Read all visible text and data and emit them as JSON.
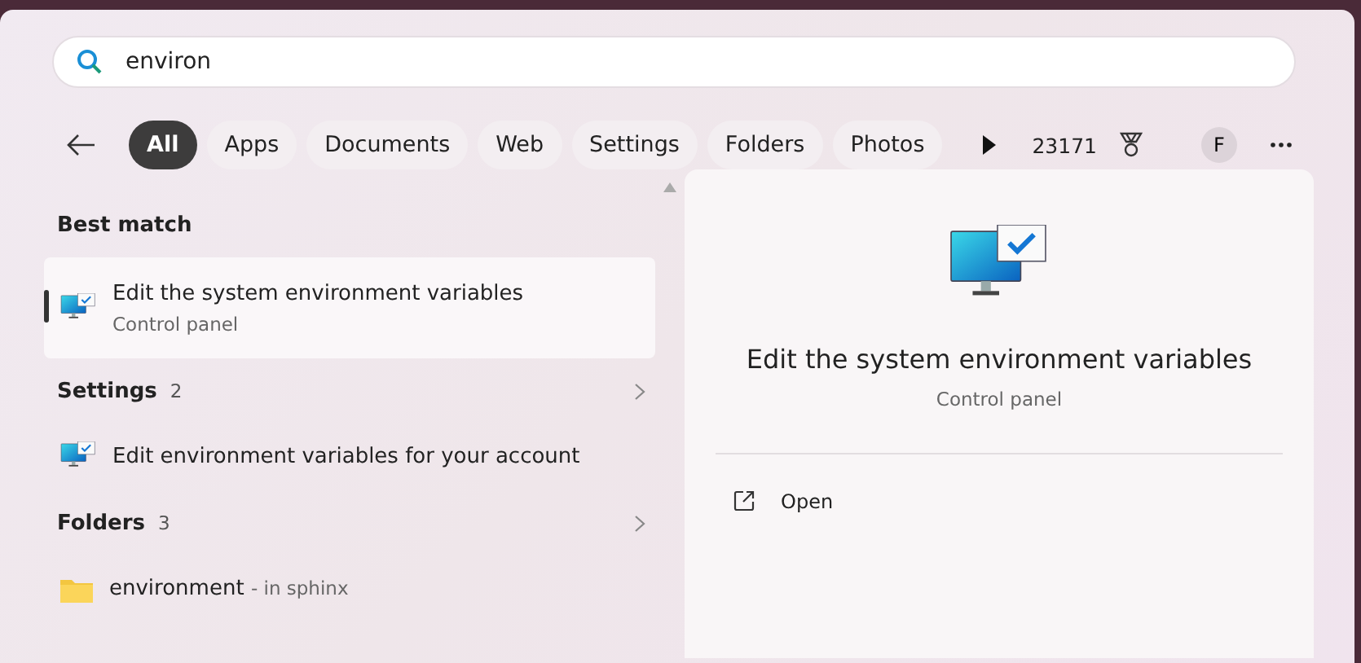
{
  "search": {
    "value": "environ"
  },
  "filters": [
    {
      "label": "All",
      "selected": true
    },
    {
      "label": "Apps",
      "selected": false
    },
    {
      "label": "Documents",
      "selected": false
    },
    {
      "label": "Web",
      "selected": false
    },
    {
      "label": "Settings",
      "selected": false
    },
    {
      "label": "Folders",
      "selected": false
    },
    {
      "label": "Photos",
      "selected": false
    }
  ],
  "points": "23171",
  "avatar": "F",
  "results": [
    {
      "kind": "header",
      "title": "Best match"
    },
    {
      "kind": "app",
      "title": "Edit the system environment variables",
      "subtitle": "Control panel",
      "selected": true
    },
    {
      "kind": "header",
      "title": "Settings",
      "count": "2"
    },
    {
      "kind": "app",
      "title": "Edit environment variables for your account",
      "selected": false
    },
    {
      "kind": "header",
      "title": "Folders",
      "count": "3"
    },
    {
      "kind": "folder",
      "title": "environment",
      "note": "- in sphinx",
      "selected": false
    }
  ],
  "preview": {
    "title": "Edit the system environment variables",
    "subtitle": "Control panel",
    "actions": [
      {
        "label": "Open"
      }
    ]
  }
}
